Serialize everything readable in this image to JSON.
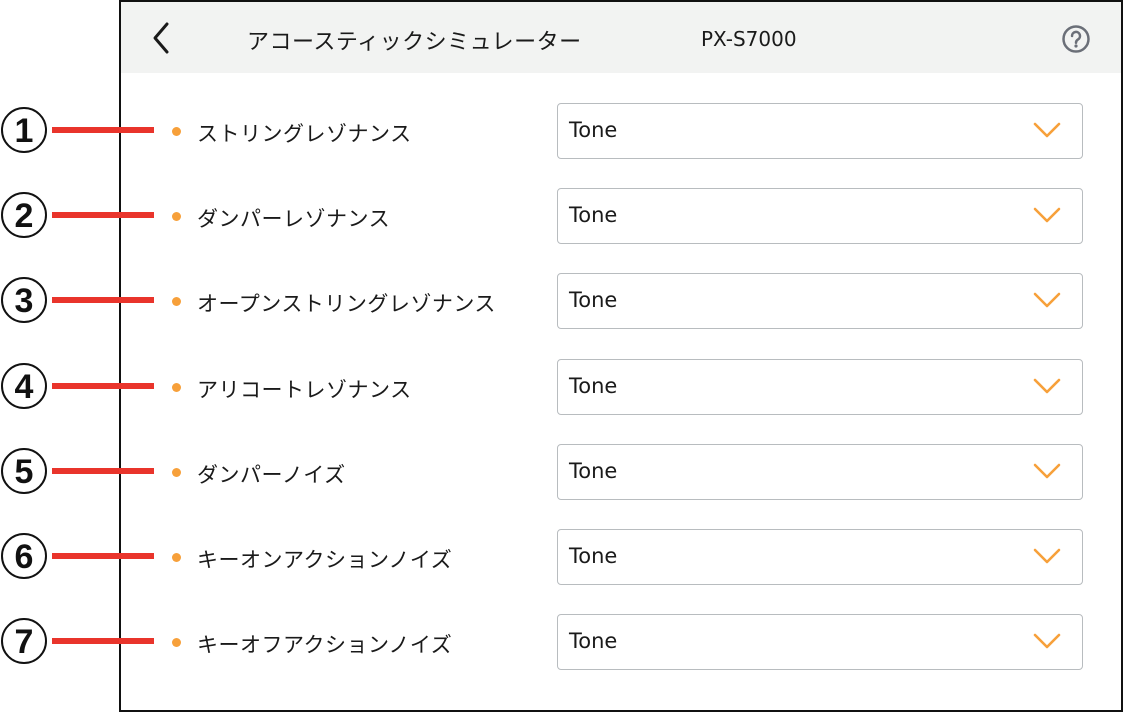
{
  "header": {
    "title": "アコースティックシミュレーター",
    "model": "PX-S7000",
    "back_icon": "chevron-left-icon",
    "help_icon": "question-circle-icon"
  },
  "colors": {
    "accent": "#f7a03a",
    "callout_line": "#e9342b",
    "header_bg": "#f2f3f2",
    "select_border": "#b8bcbf"
  },
  "rows": [
    {
      "callout": "1",
      "label": "ストリングレゾナンス",
      "value": "Tone"
    },
    {
      "callout": "2",
      "label": "ダンパーレゾナンス",
      "value": "Tone"
    },
    {
      "callout": "3",
      "label": "オープンストリングレゾナンス",
      "value": "Tone"
    },
    {
      "callout": "4",
      "label": "アリコートレゾナンス",
      "value": "Tone"
    },
    {
      "callout": "5",
      "label": "ダンパーノイズ",
      "value": "Tone"
    },
    {
      "callout": "6",
      "label": "キーオンアクションノイズ",
      "value": "Tone"
    },
    {
      "callout": "7",
      "label": "キーオフアクションノイズ",
      "value": "Tone"
    }
  ]
}
